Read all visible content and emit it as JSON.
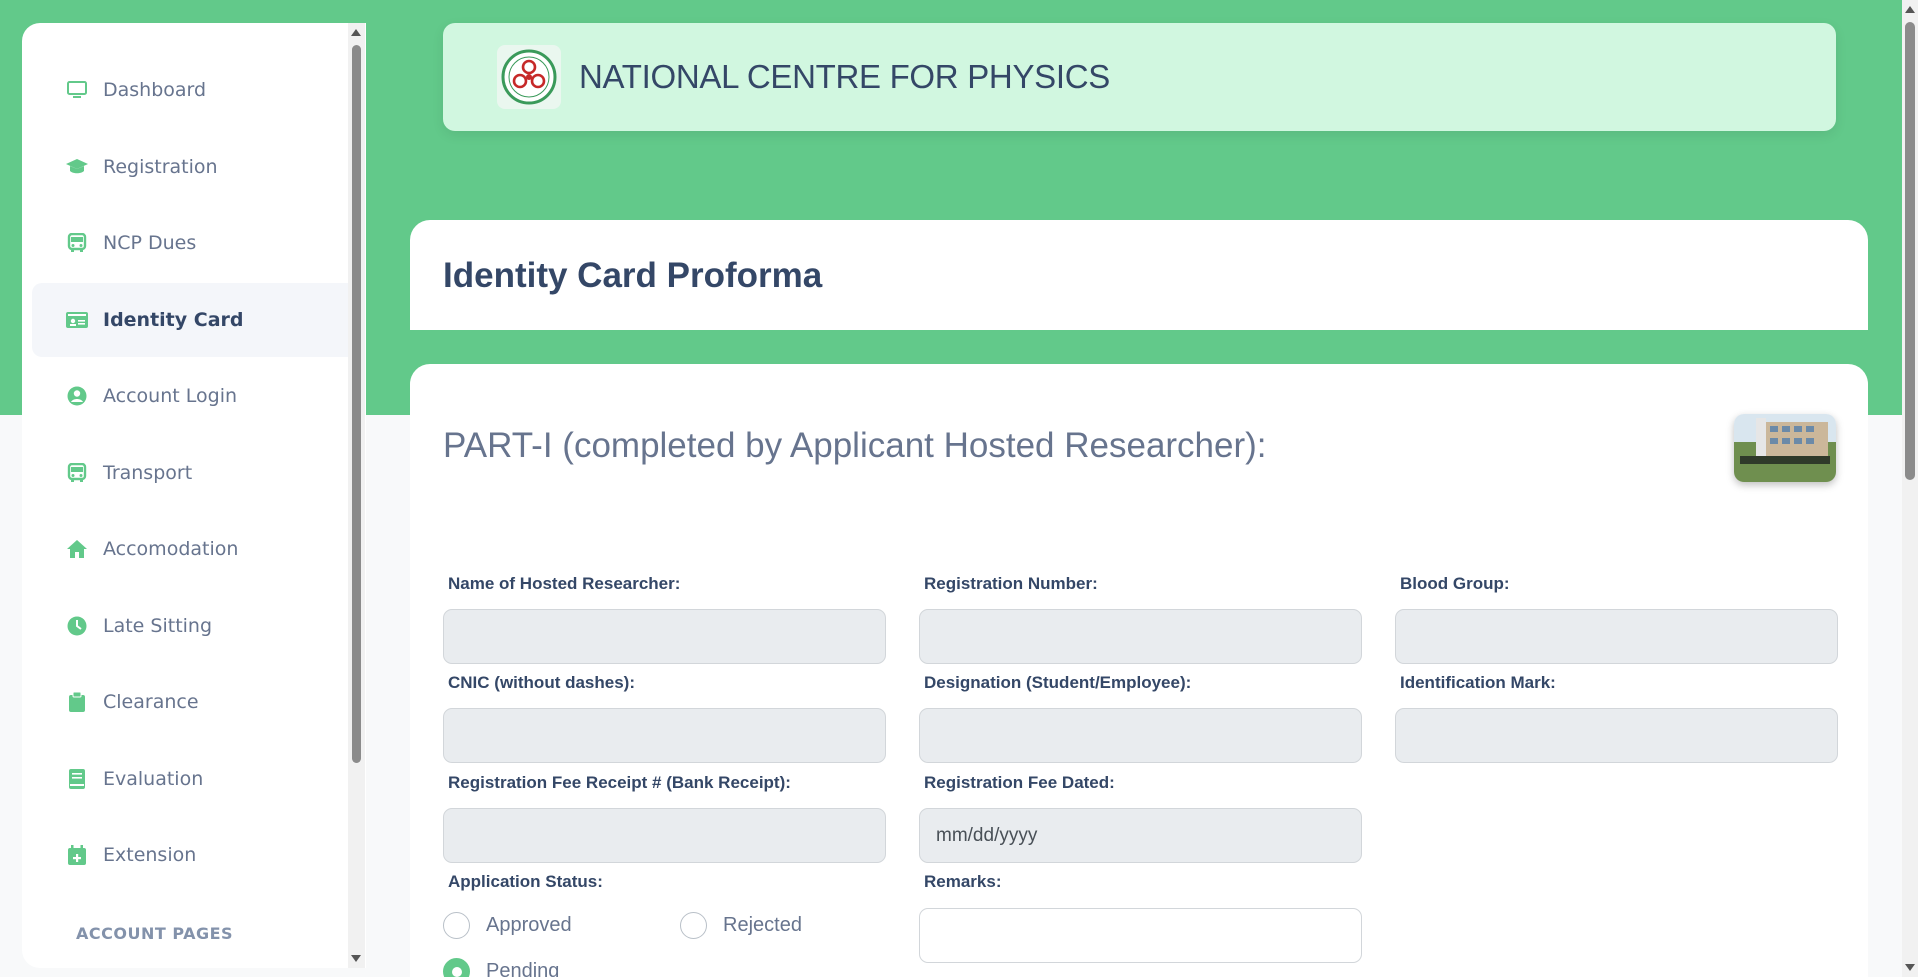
{
  "header": {
    "title": "NATIONAL CENTRE FOR PHYSICS"
  },
  "sidebar": {
    "items": [
      {
        "label": "Dashboard",
        "icon": "monitor-icon",
        "active": false
      },
      {
        "label": "Registration",
        "icon": "graduation-cap-icon",
        "active": false
      },
      {
        "label": "NCP Dues",
        "icon": "bus-icon",
        "active": false
      },
      {
        "label": "Identity Card",
        "icon": "id-card-icon",
        "active": true
      },
      {
        "label": "Account Login",
        "icon": "user-circle-icon",
        "active": false
      },
      {
        "label": "Transport",
        "icon": "bus-icon",
        "active": false
      },
      {
        "label": "Accomodation",
        "icon": "home-icon",
        "active": false
      },
      {
        "label": "Late Sitting",
        "icon": "clock-icon",
        "active": false
      },
      {
        "label": "Clearance",
        "icon": "clipboard-icon",
        "active": false
      },
      {
        "label": "Evaluation",
        "icon": "book-icon",
        "active": false
      },
      {
        "label": "Extension",
        "icon": "calendar-plus-icon",
        "active": false
      }
    ],
    "section_title": "ACCOUNT PAGES"
  },
  "page": {
    "title": "Identity Card Proforma",
    "part_title": "PART-I (completed by Applicant Hosted Researcher):"
  },
  "form": {
    "name_label": "Name of Hosted Researcher:",
    "name_value": "",
    "reg_number_label": "Registration Number:",
    "reg_number_value": "",
    "blood_group_label": "Blood Group:",
    "blood_group_value": "",
    "cnic_label": "CNIC (without dashes):",
    "cnic_value": "",
    "designation_label": "Designation (Student/Employee):",
    "designation_value": "",
    "identification_mark_label": "Identification Mark:",
    "identification_mark_value": "",
    "fee_receipt_label": "Registration Fee Receipt # (Bank Receipt):",
    "fee_receipt_value": "",
    "fee_dated_label": "Registration Fee Dated:",
    "fee_dated_placeholder": "mm/dd/yyyy",
    "status_label": "Application Status:",
    "status_options": [
      "Approved",
      "Rejected",
      "Pending"
    ],
    "status_selected": "Pending",
    "remarks_label": "Remarks:",
    "remarks_value": ""
  },
  "colors": {
    "brand_green": "#62c98a",
    "header_bg": "#d1f7e0",
    "text_dark": "#344767",
    "text_muted": "#67748e"
  }
}
